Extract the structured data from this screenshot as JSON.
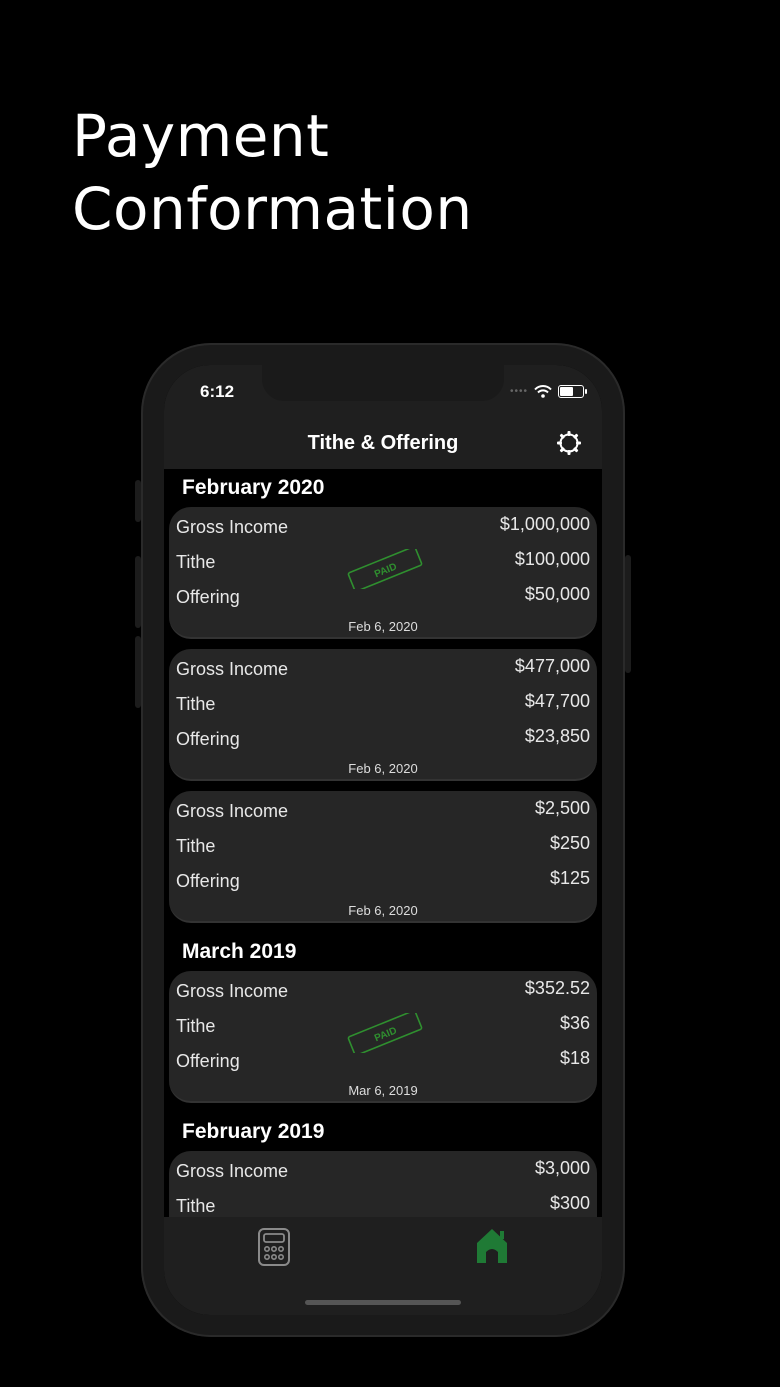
{
  "headline": {
    "line1": "Payment",
    "line2": "Conformation"
  },
  "status": {
    "time": "6:12"
  },
  "nav": {
    "title": "Tithe & Offering",
    "settings_icon": "gear-icon"
  },
  "labels": {
    "gross": "Gross Income",
    "tithe": "Tithe",
    "offering": "Offering",
    "paid_stamp": "PAID"
  },
  "sections": [
    {
      "title": "February 2020",
      "cards": [
        {
          "gross": "$1,000,000",
          "tithe": "$100,000",
          "offering": "$50,000",
          "date": "Feb 6, 2020",
          "paid": true
        },
        {
          "gross": "$477,000",
          "tithe": "$47,700",
          "offering": "$23,850",
          "date": "Feb 6, 2020",
          "paid": false
        },
        {
          "gross": "$2,500",
          "tithe": "$250",
          "offering": "$125",
          "date": "Feb 6, 2020",
          "paid": false
        }
      ]
    },
    {
      "title": "March 2019",
      "cards": [
        {
          "gross": "$352.52",
          "tithe": "$36",
          "offering": "$18",
          "date": "Mar 6, 2019",
          "paid": true
        }
      ]
    },
    {
      "title": "February 2019",
      "cards": [
        {
          "gross": "$3,000",
          "tithe": "$300"
        }
      ]
    }
  ],
  "tabs": [
    {
      "icon": "calculator-icon",
      "active": false
    },
    {
      "icon": "home-icon",
      "active": true
    }
  ],
  "colors": {
    "accent_green": "#1f7a35",
    "stamp_green": "#2f8f2f",
    "card_bg": "#262626"
  }
}
